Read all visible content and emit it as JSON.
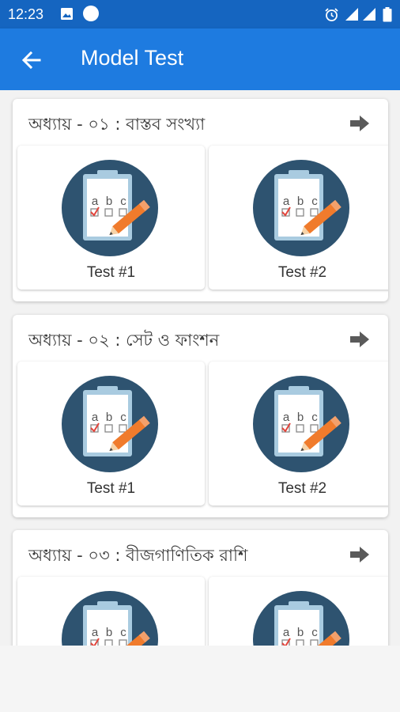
{
  "status_bar": {
    "time": "12:23",
    "icons": [
      "image-icon",
      "circle-notification-icon",
      "alarm-icon",
      "signal-icon",
      "signal-icon",
      "battery-icon"
    ]
  },
  "app_bar": {
    "title": "Model Test",
    "back_icon": "arrow-left-icon"
  },
  "colors": {
    "status_bar": "#1565c0",
    "app_bar": "#1e7be0",
    "icon_circle": "#2e5370",
    "pencil": "#f07b2c"
  },
  "chapters": [
    {
      "title": "অধ্যায় - ০১ : বাস্তব সংখ্যা",
      "arrow_icon": "arrow-right-icon",
      "tests": [
        {
          "label": "Test #1"
        },
        {
          "label": "Test #2"
        }
      ]
    },
    {
      "title": "অধ্যায় - ০২ : সেট ও ফাংশন",
      "arrow_icon": "arrow-right-icon",
      "tests": [
        {
          "label": "Test #1"
        },
        {
          "label": "Test #2"
        }
      ]
    },
    {
      "title": "অধ্যায় - ০৩ : বীজগাণিতিক রাশি",
      "arrow_icon": "arrow-right-icon",
      "tests": [
        {
          "label": ""
        },
        {
          "label": ""
        }
      ]
    }
  ],
  "test_icon": {
    "name": "clipboard-test-icon",
    "letters": [
      "a",
      "b",
      "c"
    ]
  }
}
